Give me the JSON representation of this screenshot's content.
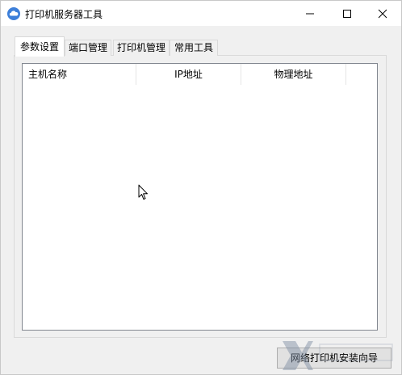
{
  "window": {
    "title": "打印机服务器工具",
    "icon": "cloud-icon"
  },
  "controls": {
    "minimize": "minimize-icon",
    "maximize": "maximize-icon",
    "close": "close-icon"
  },
  "tabs": [
    {
      "label": "参数设置",
      "active": true
    },
    {
      "label": "端口管理",
      "active": false
    },
    {
      "label": "打印机管理",
      "active": false
    },
    {
      "label": "常用工具",
      "active": false
    }
  ],
  "table": {
    "columns": [
      "主机名称",
      "IP地址",
      "物理地址"
    ],
    "rows": []
  },
  "actions": {
    "install_wizard": "网络打印机安装向导"
  },
  "colors": {
    "accent": "#3d7fd9",
    "background": "#f0f0f0",
    "border": "#828790"
  }
}
